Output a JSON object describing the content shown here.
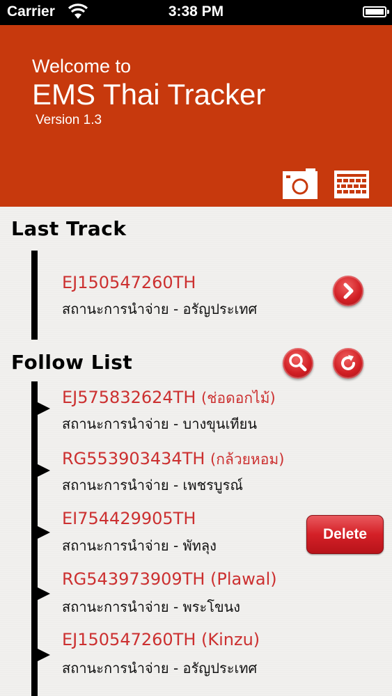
{
  "status_bar": {
    "carrier": "Carrier",
    "time": "3:38 PM",
    "battery_level": 1.0
  },
  "header": {
    "welcome": "Welcome to",
    "title": "EMS Thai Tracker",
    "version": "Version 1.3",
    "background_color": "#c7390d",
    "camera_icon": "camera-icon",
    "keyboard_icon": "keyboard-icon"
  },
  "last_track": {
    "heading": "Last Track",
    "code": "EJ150547260TH",
    "status": "สถานะการนำจ่าย - อรัญประเทศ",
    "action_icon": "chevron-right-icon"
  },
  "follow_list": {
    "heading": "Follow List",
    "search_icon": "search-icon",
    "refresh_icon": "refresh-icon",
    "delete_label": "Delete",
    "items": [
      {
        "code": "EJ575832624TH",
        "note": "(ช่อดอกไม้)",
        "status": "สถานะการนำจ่าย - บางขุนเทียน"
      },
      {
        "code": "RG553903434TH",
        "note": "(กล้วยหอม)",
        "status": "สถานะการนำจ่าย - เพชรบูรณ์"
      },
      {
        "code": "EI754429905TH",
        "note": "",
        "status": "สถานะการนำจ่าย - พัทลุง"
      },
      {
        "code": "RG543973909TH",
        "note": "(Plawal)",
        "status": "สถานะการนำจ่าย - พระโขนง"
      },
      {
        "code": "EJ150547260TH",
        "note": "(Kinzu)",
        "status": "สถานะการนำจ่าย - อรัญประเทศ"
      }
    ]
  },
  "colors": {
    "accent_red": "#cc3030",
    "button_red": "#d11f24"
  }
}
